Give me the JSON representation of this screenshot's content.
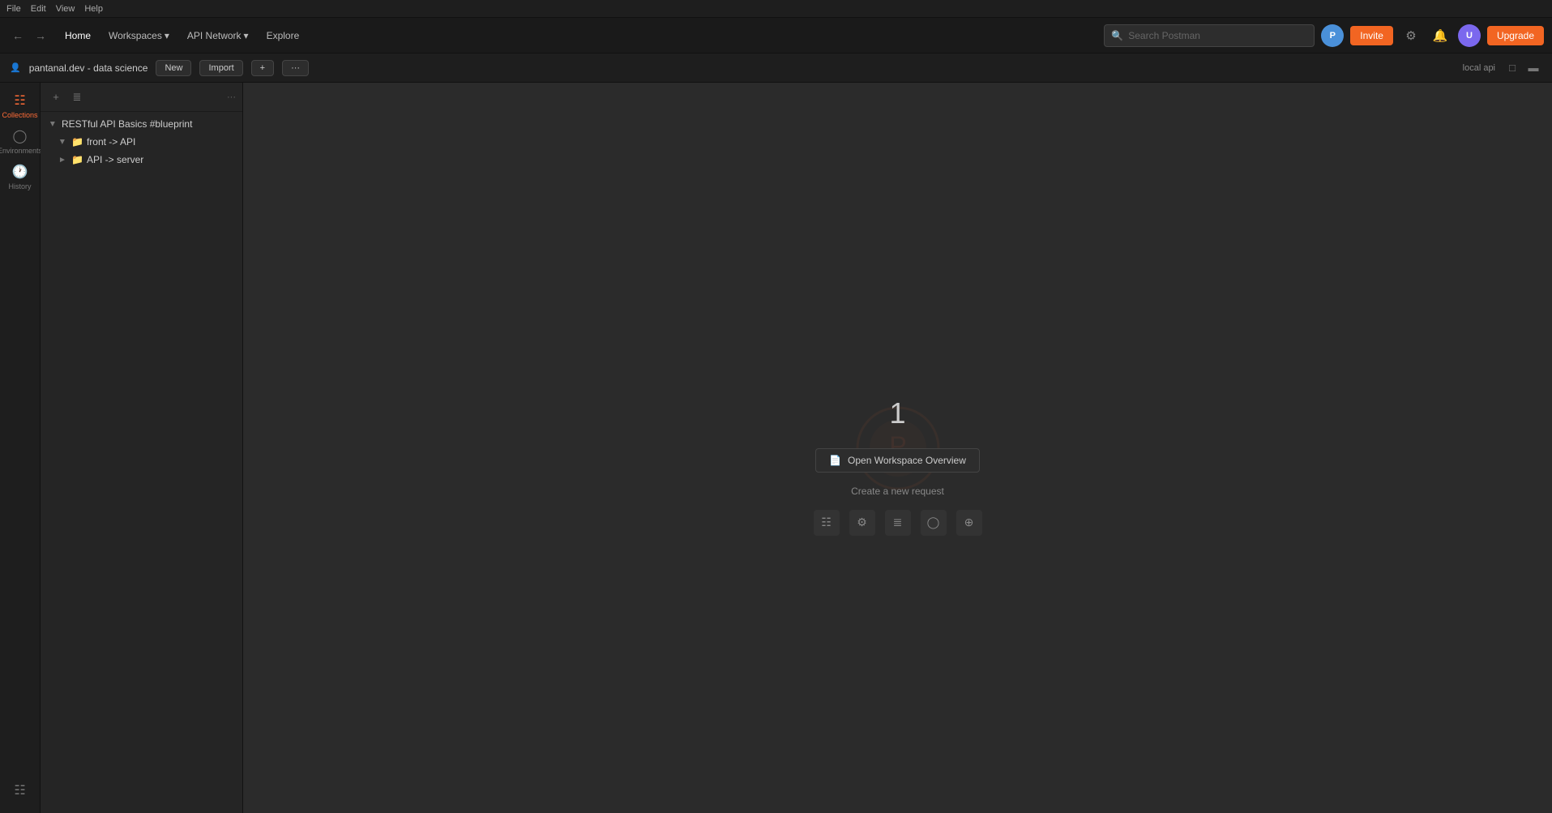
{
  "menu": {
    "items": [
      "File",
      "Edit",
      "View",
      "Help"
    ]
  },
  "toolbar": {
    "home_label": "Home",
    "workspaces_label": "Workspaces",
    "api_network_label": "API Network",
    "explore_label": "Explore",
    "search_placeholder": "Search Postman",
    "invite_label": "Invite",
    "upgrade_label": "Upgrade"
  },
  "workspace_bar": {
    "icon": "👤",
    "name": "pantanal.dev - data science",
    "new_label": "New",
    "import_label": "Import",
    "local_api_label": "local api"
  },
  "sidebar": {
    "icons": [
      {
        "id": "collections",
        "symbol": "⊞",
        "label": "Collections",
        "active": true
      },
      {
        "id": "environments",
        "symbol": "⊙",
        "label": "Environments",
        "active": false
      },
      {
        "id": "history",
        "symbol": "⌚",
        "label": "History",
        "active": false
      }
    ],
    "bottom_icons": [
      {
        "id": "runner",
        "symbol": "⊕",
        "label": "",
        "active": false
      }
    ]
  },
  "collections_panel": {
    "items": [
      {
        "id": "collection-1",
        "name": "RESTful API Basics #blueprint",
        "expanded": true,
        "indent": 0,
        "children": [
          {
            "id": "folder-front-api",
            "name": "front -> API",
            "expanded": true,
            "indent": 1
          },
          {
            "id": "folder-api-server",
            "name": "API -> server",
            "expanded": false,
            "indent": 1
          }
        ]
      }
    ]
  },
  "main": {
    "number": "1",
    "open_workspace_label": "Open Workspace Overview",
    "create_request_label": "Create a new request",
    "request_icons": [
      "⊞",
      "⚙",
      "⊿",
      "☊",
      "⊕"
    ]
  }
}
